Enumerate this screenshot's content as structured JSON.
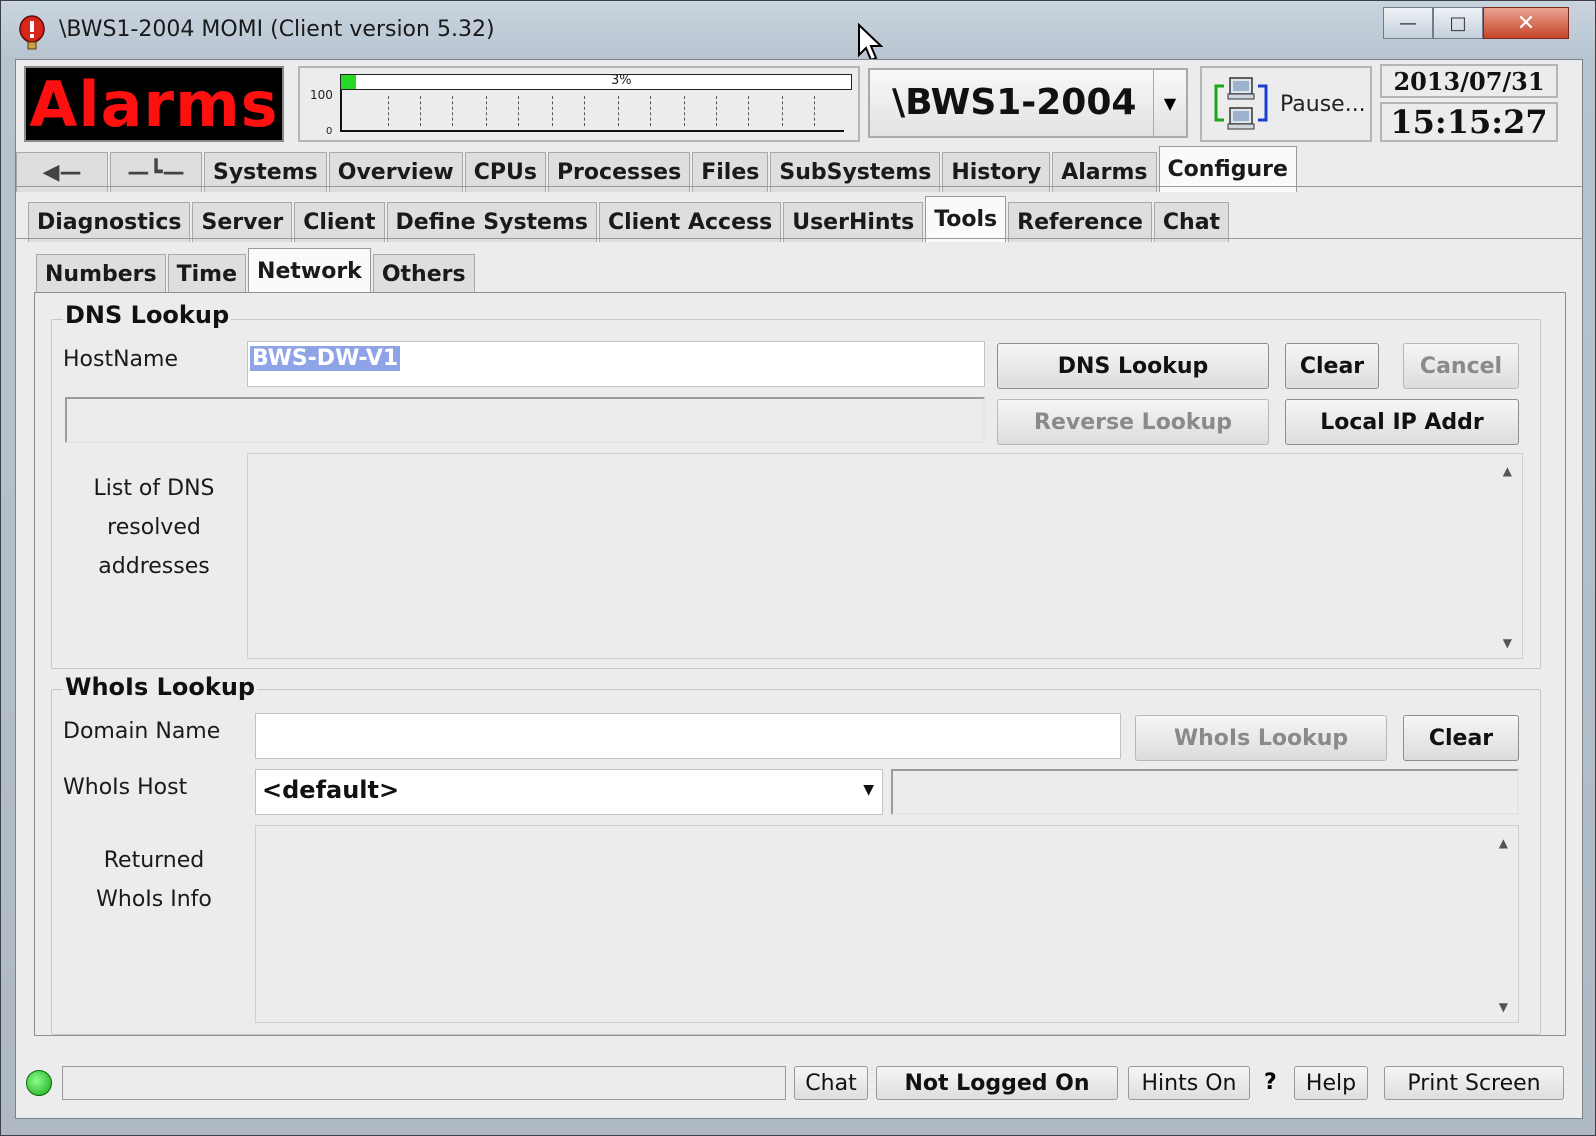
{
  "window": {
    "title": "\\BWS1-2004 MOMI (Client version 5.32)",
    "min_icon": "minimize-icon",
    "max_icon": "maximize-icon",
    "close_icon": "close-icon"
  },
  "header": {
    "alarms_label": "Alarms",
    "cpu": {
      "percent_label": "3%",
      "percent_value": 3,
      "axis_max": "100",
      "axis_min": "0"
    },
    "system_name": "\\BWS1-2004",
    "pause_label": "Pause...",
    "date": "2013/07/31",
    "time": "15:15:27",
    "colors": {
      "alarms_bg": "#000000",
      "alarms_text": "#ff1010",
      "cpu_fill": "#27d827"
    }
  },
  "main_tabs": [
    "Systems",
    "Overview",
    "CPUs",
    "Processes",
    "Files",
    "SubSystems",
    "History",
    "Alarms",
    "Configure"
  ],
  "main_tabs_active": "Configure",
  "sub_tabs": [
    "Diagnostics",
    "Server",
    "Client",
    "Define Systems",
    "Client Access",
    "UserHints",
    "Tools",
    "Reference",
    "Chat"
  ],
  "sub_tabs_active": "Tools",
  "tool_tabs": [
    "Numbers",
    "Time",
    "Network",
    "Others"
  ],
  "tool_tabs_active": "Network",
  "dns": {
    "group_title": "DNS Lookup",
    "hostname_label": "HostName",
    "hostname_value": "BWS-DW-V1",
    "lookup_button": "DNS Lookup",
    "clear_button": "Clear",
    "cancel_button": "Cancel",
    "reverse_button": "Reverse Lookup",
    "local_ip_button": "Local IP Addr",
    "list_label_1": "List of DNS",
    "list_label_2": "resolved",
    "list_label_3": "addresses"
  },
  "whois": {
    "group_title": "WhoIs Lookup",
    "domain_label": "Domain Name",
    "domain_value": "",
    "lookup_button": "WhoIs Lookup",
    "clear_button": "Clear",
    "host_label": "WhoIs Host",
    "host_value": "<default>",
    "returned_label_1": "Returned",
    "returned_label_2": "WhoIs Info"
  },
  "statusbar": {
    "chat_button": "Chat",
    "login_button": "Not Logged On",
    "hints_button": "Hints On",
    "question_label": "?",
    "help_button": "Help",
    "print_button": "Print Screen"
  }
}
